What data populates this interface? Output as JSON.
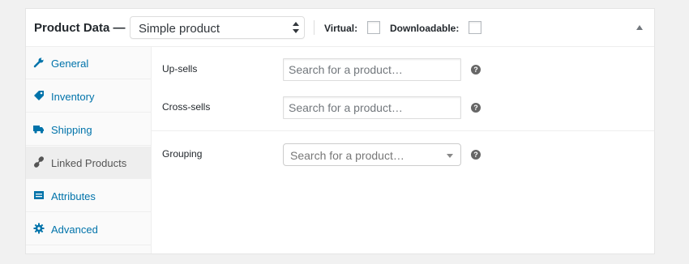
{
  "header": {
    "title": "Product Data —",
    "product_type": "Simple product",
    "virtual_label": "Virtual:",
    "downloadable_label": "Downloadable:"
  },
  "tabs": [
    {
      "label": "General",
      "icon": "wrench-icon"
    },
    {
      "label": "Inventory",
      "icon": "tag-icon"
    },
    {
      "label": "Shipping",
      "icon": "truck-icon"
    },
    {
      "label": "Linked Products",
      "icon": "link-icon",
      "active": true
    },
    {
      "label": "Attributes",
      "icon": "list-icon"
    },
    {
      "label": "Advanced",
      "icon": "gear-icon"
    }
  ],
  "fields": {
    "upsells": {
      "label": "Up-sells",
      "placeholder": "Search for a product…"
    },
    "crosssells": {
      "label": "Cross-sells",
      "placeholder": "Search for a product…"
    },
    "grouping": {
      "label": "Grouping",
      "placeholder": "Search for a product…"
    }
  },
  "help_glyph": "?",
  "colors": {
    "link": "#0073aa",
    "active_tab_bg": "#eeeeee",
    "tab_bg": "#fafafa"
  }
}
